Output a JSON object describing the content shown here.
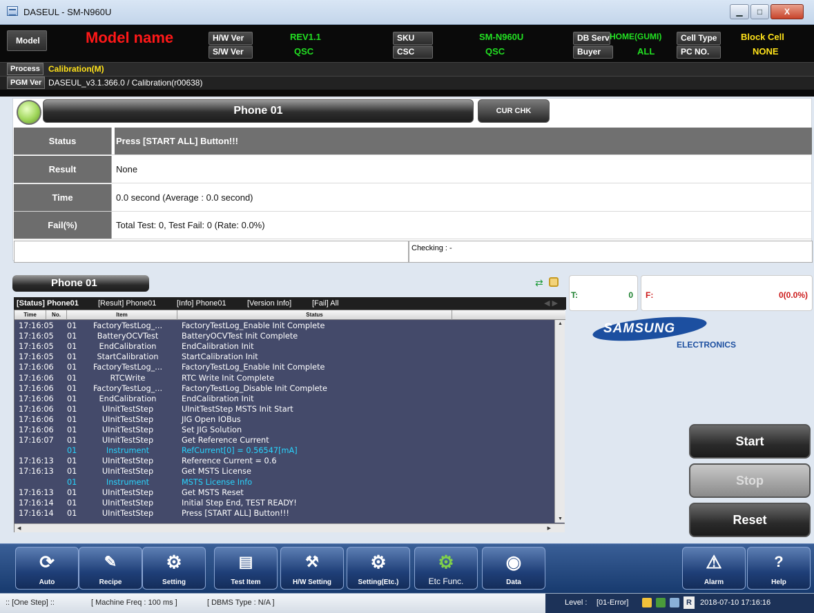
{
  "window": {
    "title": "DASEUL - SM-N960U",
    "min": "▁",
    "max": "□",
    "close": "X"
  },
  "header": {
    "model_label": "Model",
    "model_name": "Model name",
    "hw_ver_label": "H/W Ver",
    "hw_ver": "REV1.1",
    "sw_ver_label": "S/W Ver",
    "sw_ver": "QSC",
    "sku_label": "SKU",
    "sku": "SM-N960U",
    "csc_label": "CSC",
    "csc": "QSC",
    "db_serv_label": "DB Serv",
    "db_serv": "HOME(GUMI)",
    "buyer_label": "Buyer",
    "buyer": "ALL",
    "cell_type_label": "Cell Type",
    "cell_type": "Block Cell",
    "pc_no_label": "PC NO.",
    "pc_no": "NONE",
    "process_label": "Process",
    "process": "Calibration(M)",
    "pgm_ver_label": "PGM Ver",
    "pgm_ver": "DASEUL_v3.1.366.0 / Calibration(r00638)"
  },
  "phone_panel": {
    "title": "Phone 01",
    "cur_chk": "CUR CHK",
    "rows": [
      {
        "label": "Status",
        "value": "Press [START ALL] Button!!!"
      },
      {
        "label": "Result",
        "value": "None"
      },
      {
        "label": "Time",
        "value": "0.0 second (Average : 0.0 second)"
      },
      {
        "label": "Fail(%)",
        "value": "Total Test: 0, Test Fail: 0 (Rate: 0.0%)"
      }
    ],
    "checking": "Checking : -"
  },
  "log": {
    "phone_button": "Phone 01",
    "tabs": [
      "[Status] Phone01",
      "[Result] Phone01",
      "[Info] Phone01",
      "[Version Info]",
      "[Fail] All"
    ],
    "columns": [
      "Time",
      "No.",
      "Item",
      "Status"
    ],
    "rows": [
      {
        "time": "17:16:05",
        "no": "01",
        "item": "FactoryTestLog_...",
        "status": "FactoryTestLog_Enable Init Complete"
      },
      {
        "time": "17:16:05",
        "no": "01",
        "item": "BatteryOCVTest",
        "status": "BatteryOCVTest Init Complete"
      },
      {
        "time": "17:16:05",
        "no": "01",
        "item": "EndCalibration",
        "status": "EndCalibration Init"
      },
      {
        "time": "17:16:05",
        "no": "01",
        "item": "StartCalibration",
        "status": "StartCalibration Init"
      },
      {
        "time": "17:16:06",
        "no": "01",
        "item": "FactoryTestLog_...",
        "status": "FactoryTestLog_Enable Init Complete"
      },
      {
        "time": "17:16:06",
        "no": "01",
        "item": "RTCWrite",
        "status": "RTC Write Init Complete"
      },
      {
        "time": "17:16:06",
        "no": "01",
        "item": "FactoryTestLog_...",
        "status": "FactoryTestLog_Disable Init Complete"
      },
      {
        "time": "17:16:06",
        "no": "01",
        "item": "EndCalibration",
        "status": "EndCalibration Init"
      },
      {
        "time": "17:16:06",
        "no": "01",
        "item": "UInitTestStep",
        "status": "UInitTestStep MSTS Init Start"
      },
      {
        "time": "17:16:06",
        "no": "01",
        "item": "UInitTestStep",
        "status": "JIG Open IOBus"
      },
      {
        "time": "17:16:06",
        "no": "01",
        "item": "UInitTestStep",
        "status": "Set JIG Solution"
      },
      {
        "time": "17:16:07",
        "no": "01",
        "item": "UInitTestStep",
        "status": "Get Reference Current"
      },
      {
        "time": "",
        "no": "01",
        "item": "Instrument",
        "status": "RefCurrent[0] = 0.56547[mA]",
        "highlight": true
      },
      {
        "time": "17:16:13",
        "no": "01",
        "item": "UInitTestStep",
        "status": "Reference Current = 0.6"
      },
      {
        "time": "17:16:13",
        "no": "01",
        "item": "UInitTestStep",
        "status": "Get MSTS License"
      },
      {
        "time": "",
        "no": "01",
        "item": "Instrument",
        "status": "MSTS License Info",
        "highlight": true
      },
      {
        "time": "17:16:13",
        "no": "01",
        "item": "UInitTestStep",
        "status": "Get MSTS Reset"
      },
      {
        "time": "17:16:14",
        "no": "01",
        "item": "UInitTestStep",
        "status": "Initial Step End, TEST READY!"
      },
      {
        "time": "17:16:14",
        "no": "01",
        "item": "UInitTestStep",
        "status": "Press [START ALL] Button!!!"
      }
    ]
  },
  "counters": {
    "t_label": "T:",
    "t_value": "0",
    "f_label": "F:",
    "f_value": "0(0.0%)"
  },
  "brand": {
    "line1": "SAMSUNG",
    "line2": "ELECTRONICS"
  },
  "controls": {
    "start": "Start",
    "stop": "Stop",
    "reset": "Reset"
  },
  "toolbar": [
    {
      "label": "Auto",
      "icon": "refresh-icon"
    },
    {
      "label": "Recipe",
      "icon": "recipe-icon"
    },
    {
      "label": "Setting",
      "icon": "gear-icon"
    },
    {
      "label": "Test Item",
      "icon": "document-search-icon"
    },
    {
      "label": "H/W Setting",
      "icon": "hw-setting-icon"
    },
    {
      "label": "Setting(Etc.)",
      "icon": "gear-plus-icon"
    },
    {
      "label": "Etc Func.",
      "icon": "gear-green-icon"
    },
    {
      "label": "Data",
      "icon": "disc-icon"
    },
    {
      "label": "Alarm",
      "icon": "warning-icon"
    },
    {
      "label": "Help",
      "icon": "help-icon"
    }
  ],
  "statusbar": {
    "one_step": ":: [One Step] ::",
    "machine_freq": "[ Machine Freq : 100 ms ]",
    "dbms": "[ DBMS Type : N/A ]",
    "level_label": "Level :",
    "level": "[01-Error]",
    "r_label": "R",
    "datetime": "2018-07-10 17:16:16"
  },
  "colors": {
    "green": "#22e022",
    "yellow": "#ffe21a",
    "red": "#ff1818",
    "log_bg": "#444a6a",
    "log_highlight": "#28d6ff",
    "samsung_blue": "#1c4fa0"
  }
}
